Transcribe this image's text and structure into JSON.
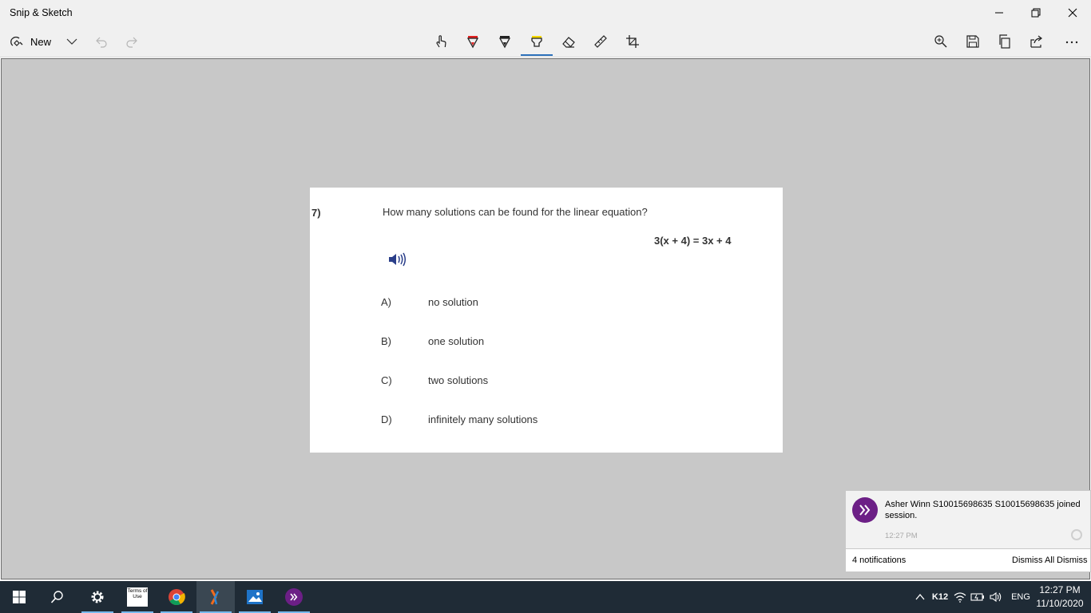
{
  "window": {
    "title": "Snip & Sketch",
    "minimize_icon": "minimize-icon",
    "restore_icon": "restore-icon",
    "close_icon": "close-icon"
  },
  "toolbar": {
    "new_label": "New",
    "tools": [
      "touch-writing-icon",
      "ballpoint-pen-icon",
      "pencil-icon",
      "highlighter-icon",
      "eraser-icon",
      "ruler-icon",
      "crop-icon"
    ],
    "active_tool": "highlighter-icon",
    "right_tools": [
      "zoom-icon",
      "save-icon",
      "copy-icon",
      "share-icon",
      "more-icon"
    ],
    "accent_color": "#2b6fb8"
  },
  "question": {
    "number": "7)",
    "text": "How many solutions can be found for the linear equation?",
    "equation": "3(x + 4) = 3x + 4",
    "options": [
      {
        "letter": "A)",
        "text": "no solution"
      },
      {
        "letter": "B)",
        "text": "one solution"
      },
      {
        "letter": "C)",
        "text": "two solutions"
      },
      {
        "letter": "D)",
        "text": "infinitely many solutions"
      }
    ]
  },
  "notification": {
    "message": "Asher Winn S10015698635 S10015698635 joined session.",
    "time": "12:27 PM",
    "count_label": "4 notifications",
    "dismiss_all_label": "Dismiss All",
    "dismiss_label": "Dismiss",
    "icon_color": "#6c1f86"
  },
  "taskbar": {
    "apps": [
      "start-icon",
      "search-icon",
      "settings-icon",
      "terms-of-use-icon",
      "chrome-icon",
      "snip-sketch-icon",
      "photos-icon",
      "classlink-icon"
    ],
    "terms_label": "Terms of Use",
    "tray_k12": "K12",
    "tray_lang": "ENG",
    "clock_time": "12:27 PM",
    "clock_date": "11/10/2020"
  }
}
